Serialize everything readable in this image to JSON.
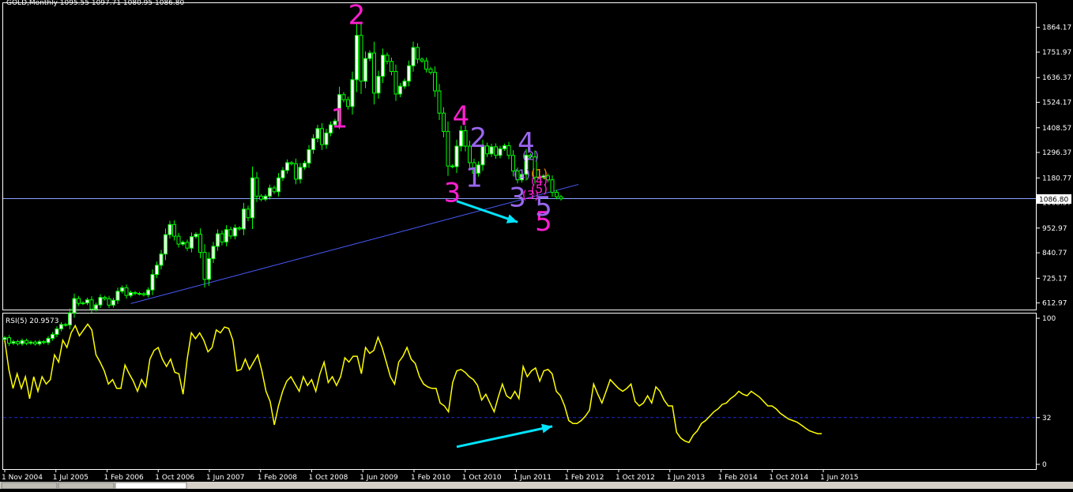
{
  "main_header": "GOLD,Monthly  1095.55 1097.71 1080.95 1086.80",
  "rsi_header": "RSI(5) 20.9573",
  "price_tag": "1086.80",
  "colors": {
    "background": "#000000",
    "frame": "#ffffff",
    "bull_candle": "#ffffff",
    "bear_candle": "#000000",
    "candle_wick": "#00ff00",
    "trendline": "#4a5cff",
    "price_line": "#8ea0ff",
    "rsi_line": "#ffff00",
    "rsi_level": "#1a2bd8",
    "arrow": "#00e5ff",
    "wave_magenta": "#ff1fd0",
    "wave_purple": "#9966ee",
    "wave_orange": "#ff8c00"
  },
  "chart_data": [
    {
      "type": "candlestick",
      "title": "GOLD,Monthly",
      "ohlc_last": {
        "open": 1095.55,
        "high": 1097.71,
        "low": 1080.95,
        "close": 1086.8
      },
      "y_ticks": [
        "1864.17",
        "1751.97",
        "1636.37",
        "1524.17",
        "1408.57",
        "1296.37",
        "1180.77",
        "1068.57",
        "952.97",
        "840.77",
        "725.17",
        "612.97"
      ],
      "ylim": [
        590,
        1960
      ],
      "x_ticks": [
        "1 Nov 2004",
        "1 Jul 2005",
        "1 Feb 2006",
        "1 Oct 2006",
        "1 Jun 2007",
        "1 Feb 2008",
        "1 Oct 2008",
        "1 Jun 2009",
        "1 Feb 2010",
        "1 Oct 2010",
        "1 Jun 2011",
        "1 Feb 2012",
        "1 Oct 2012",
        "1 Jun 2013",
        "1 Feb 2014",
        "1 Oct 2014",
        "1 Jun 2015"
      ],
      "first_month": "2004-11",
      "closes": [
        455,
        430,
        437,
        428,
        442,
        430,
        435,
        427,
        437,
        433,
        452,
        470,
        495,
        515,
        513,
        568,
        633,
        611,
        613,
        627,
        585,
        604,
        638,
        632,
        603,
        625,
        666,
        682,
        647,
        660,
        656,
        655,
        650,
        672,
        742,
        784,
        835,
        923,
        969,
        916,
        880,
        888,
        862,
        914,
        925,
        843,
        720,
        814,
        870,
        927,
        890,
        946,
        917,
        954,
        949,
        1039,
        1000,
        1181,
        1098,
        1084,
        1098,
        1135,
        1118,
        1181,
        1215,
        1250,
        1245,
        1175,
        1229,
        1248,
        1309,
        1360,
        1405,
        1332,
        1385,
        1422,
        1439,
        1559,
        1536,
        1505,
        1627,
        1828,
        1620,
        1723,
        1748,
        1566,
        1642,
        1738,
        1710,
        1664,
        1562,
        1597,
        1620,
        1690,
        1773,
        1720,
        1712,
        1675,
        1660,
        1576,
        1475,
        1392,
        1235,
        1232,
        1325,
        1395,
        1325,
        1250,
        1202,
        1240,
        1326,
        1290,
        1322,
        1283,
        1313,
        1327,
        1283,
        1212,
        1172,
        1197,
        1284,
        1276,
        1184,
        1183,
        1190,
        1172,
        1115,
        1095,
        1086
      ],
      "level_line": 1086.8,
      "trendline": [
        {
          "x": "2007-04",
          "y": 610
        },
        {
          "x": "2015-11",
          "y": 1151
        }
      ],
      "wave_labels": [
        {
          "text": "1",
          "x": "2011-04",
          "y": 1410,
          "color": "wave_magenta",
          "size": "big"
        },
        {
          "text": "2",
          "x": "2011-08",
          "y": 1880,
          "color": "wave_magenta",
          "size": "big"
        },
        {
          "text": "3",
          "x": "2013-06",
          "y": 1072,
          "color": "wave_magenta",
          "size": "big"
        },
        {
          "text": "4",
          "x": "2013-08",
          "y": 1420,
          "color": "wave_magenta",
          "size": "big"
        },
        {
          "text": "5",
          "x": "2015-03",
          "y": 942,
          "color": "wave_magenta",
          "size": "big"
        },
        {
          "text": "1",
          "x": "2013-11",
          "y": 1140,
          "color": "wave_purple",
          "size": "big"
        },
        {
          "text": "2",
          "x": "2013-12",
          "y": 1322,
          "color": "wave_purple",
          "size": "big"
        },
        {
          "text": "3",
          "x": "2014-09",
          "y": 1050,
          "color": "wave_purple",
          "size": "big"
        },
        {
          "text": "4",
          "x": "2014-11",
          "y": 1300,
          "color": "wave_purple",
          "size": "big"
        },
        {
          "text": "5",
          "x": "2015-03",
          "y": 1010,
          "color": "wave_purple",
          "size": "big"
        },
        {
          "text": "(2)",
          "x": "2014-12",
          "y": 1262,
          "color": "wave_purple",
          "size": "small"
        },
        {
          "text": "(1)",
          "x": "2014-10",
          "y": 1180,
          "color": "wave_purple",
          "size": "small"
        },
        {
          "text": "(3)",
          "x": "2014-12",
          "y": 1085,
          "color": "wave_magenta",
          "size": "small"
        },
        {
          "text": "(1)",
          "x": "2015-02",
          "y": 1182,
          "color": "wave_orange",
          "size": "small"
        },
        {
          "text": "(4)",
          "x": "2015-02",
          "y": 1152,
          "color": "wave_magenta",
          "size": "small"
        },
        {
          "text": "(5)",
          "x": "2015-02",
          "y": 1112,
          "color": "wave_magenta",
          "size": "small"
        }
      ],
      "arrow": {
        "from": {
          "x": "2013-07",
          "y": 1075
        },
        "to": {
          "x": "2014-09",
          "y": 980
        }
      }
    },
    {
      "type": "line",
      "title": "RSI(5) 20.9573",
      "ylim": [
        0,
        100
      ],
      "y_ticks": [
        "100",
        "32",
        "0"
      ],
      "level": 32,
      "values": [
        85,
        65,
        52,
        62,
        52,
        60,
        45,
        60,
        50,
        60,
        55,
        58,
        75,
        70,
        85,
        80,
        90,
        95,
        88,
        92,
        96,
        92,
        75,
        70,
        64,
        55,
        58,
        52,
        52,
        68,
        62,
        57,
        50,
        58,
        53,
        72,
        78,
        80,
        72,
        67,
        72,
        63,
        62,
        48,
        72,
        90,
        86,
        90,
        85,
        77,
        80,
        92,
        90,
        94,
        93,
        85,
        64,
        65,
        72,
        65,
        70,
        75,
        64,
        50,
        43,
        27,
        40,
        50,
        57,
        60,
        55,
        50,
        60,
        54,
        58,
        50,
        62,
        70,
        56,
        60,
        54,
        60,
        73,
        70,
        74,
        74,
        62,
        80,
        76,
        78,
        87,
        80,
        70,
        60,
        55,
        70,
        74,
        80,
        72,
        69,
        60,
        55,
        53,
        52,
        52,
        42,
        40,
        36,
        56,
        64,
        65,
        63,
        60,
        58,
        54,
        44,
        48,
        42,
        36,
        46,
        55,
        47,
        45,
        50,
        45,
        67,
        60,
        64,
        66,
        57,
        64,
        65,
        62,
        50,
        47,
        40,
        30,
        28,
        28,
        30,
        33,
        37,
        55,
        48,
        42,
        50,
        58,
        55,
        52,
        50,
        52,
        55,
        43,
        40,
        42,
        47,
        42,
        53,
        50,
        44,
        40,
        40,
        22,
        18,
        16,
        15,
        20,
        23,
        28,
        30,
        33,
        36,
        38,
        41,
        42,
        45,
        47,
        50,
        48,
        47,
        50,
        48,
        46,
        43,
        40,
        40,
        38,
        35,
        33,
        31,
        30,
        29,
        27,
        25,
        23,
        22,
        21,
        21
      ],
      "arrow": {
        "from": {
          "x": "2013-07",
          "y": 12
        },
        "to": {
          "x": "2015-05",
          "y": 26
        }
      }
    }
  ]
}
